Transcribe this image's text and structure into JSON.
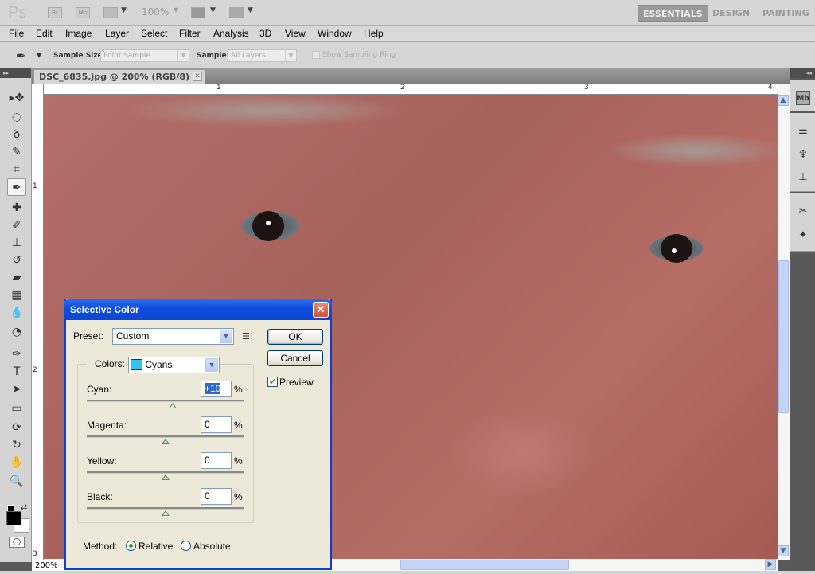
{
  "appbar": {
    "logo": "Ps",
    "bridge_label": "Br",
    "minibridge_label": "Mb",
    "zoom_level": "100%",
    "workspaces": [
      {
        "label": "ESSENTIALS",
        "active": true
      },
      {
        "label": "DESIGN",
        "active": false
      },
      {
        "label": "PAINTING",
        "active": false
      }
    ]
  },
  "menubar": {
    "items": [
      "File",
      "Edit",
      "Image",
      "Layer",
      "Select",
      "Filter",
      "Analysis",
      "3D",
      "View",
      "Window",
      "Help"
    ]
  },
  "options": {
    "sample_size_label": "Sample Size:",
    "sample_size_value": "Point Sample",
    "sample_label": "Sample:",
    "sample_value": "All Layers",
    "sampling_ring_label": "Show Sampling Ring",
    "sampling_ring_checked": false
  },
  "document": {
    "tab_title": "DSC_6835.jpg @ 200% (RGB/8) *",
    "zoom": "200%",
    "ruler_top": [
      "1",
      "2",
      "3",
      "4"
    ],
    "ruler_left": [
      "1",
      "2",
      "3"
    ]
  },
  "toolbox": {
    "tools": [
      {
        "name": "move",
        "glyph": "▸✥"
      },
      {
        "name": "marquee",
        "glyph": "◌"
      },
      {
        "name": "lasso",
        "glyph": "ꝺ"
      },
      {
        "name": "quick-selection",
        "glyph": "✎"
      },
      {
        "name": "crop",
        "glyph": "⌗"
      },
      {
        "name": "eyedropper",
        "glyph": "✒",
        "active": true
      },
      {
        "name": "healing-brush",
        "glyph": "✚"
      },
      {
        "name": "brush",
        "glyph": "✐"
      },
      {
        "name": "clone-stamp",
        "glyph": "⊥"
      },
      {
        "name": "history-brush",
        "glyph": "↺"
      },
      {
        "name": "eraser",
        "glyph": "▰"
      },
      {
        "name": "gradient",
        "glyph": "▦"
      },
      {
        "name": "blur",
        "glyph": "💧"
      },
      {
        "name": "dodge",
        "glyph": "◔"
      },
      {
        "name": "pen",
        "glyph": "✑"
      },
      {
        "name": "type",
        "glyph": "T"
      },
      {
        "name": "path-selection",
        "glyph": "➤"
      },
      {
        "name": "shape",
        "glyph": "▭"
      },
      {
        "name": "3d-rotate",
        "glyph": "⟳"
      },
      {
        "name": "3d-orbit",
        "glyph": "↻"
      },
      {
        "name": "hand",
        "glyph": "✋"
      },
      {
        "name": "zoom",
        "glyph": "🔍"
      }
    ],
    "foreground_color": "#000000",
    "background_color": "#ffffff"
  },
  "dock": {
    "icons": [
      "mini-bridge",
      "adjustments",
      "brushes",
      "clone-source",
      "tool-presets",
      "3d-panel"
    ]
  },
  "dialog": {
    "title": "Selective Color",
    "preset_label": "Preset:",
    "preset_value": "Custom",
    "ok_label": "OK",
    "cancel_label": "Cancel",
    "preview_label": "Preview",
    "preview_checked": true,
    "colors_label": "Colors:",
    "colors_value": "Cyans",
    "colors_swatch": "#33c6ee",
    "sliders": [
      {
        "label": "Cyan:",
        "value": "+10",
        "unit": "%",
        "percent": 10
      },
      {
        "label": "Magenta:",
        "value": "0",
        "unit": "%",
        "percent": 0
      },
      {
        "label": "Yellow:",
        "value": "0",
        "unit": "%",
        "percent": 0
      },
      {
        "label": "Black:",
        "value": "0",
        "unit": "%",
        "percent": 0
      }
    ],
    "method_label": "Method:",
    "method_options": [
      "Relative",
      "Absolute"
    ],
    "method_selected": "Relative"
  }
}
